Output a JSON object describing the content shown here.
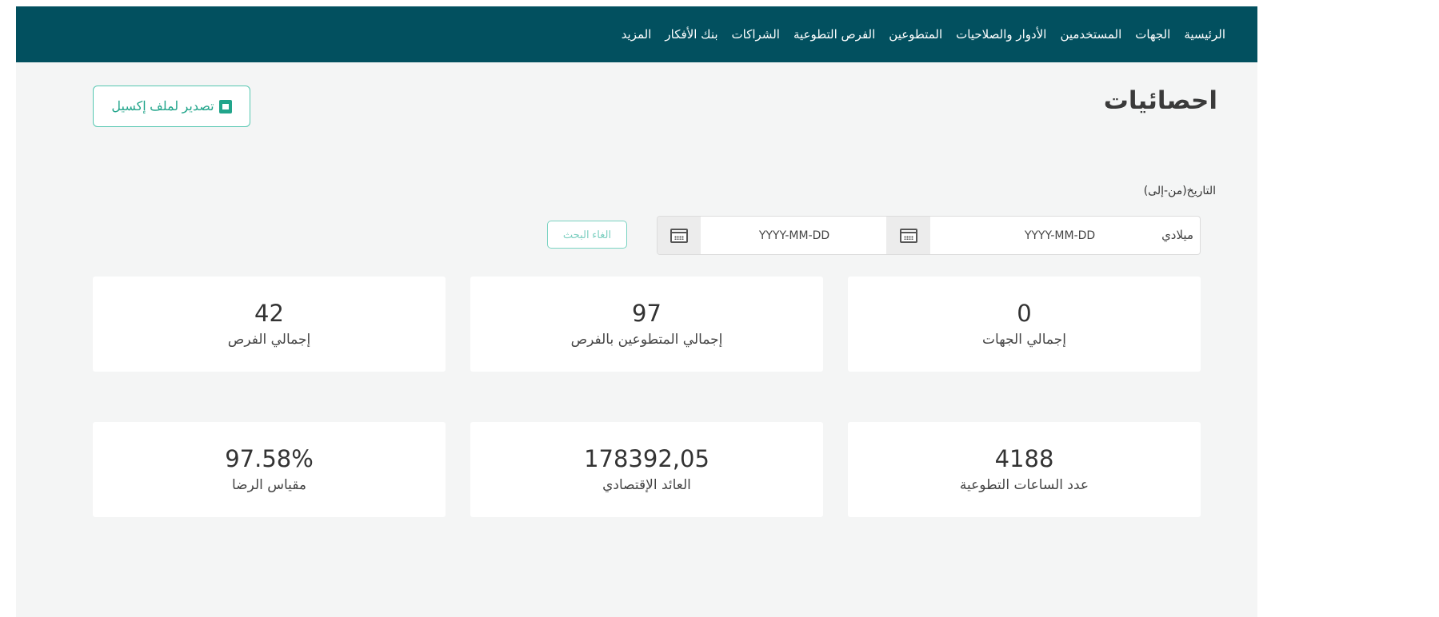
{
  "nav": {
    "items": [
      {
        "label": "الرئيسية"
      },
      {
        "label": "الجهات"
      },
      {
        "label": "المستخدمين"
      },
      {
        "label": "الأدوار والصلاحيات"
      },
      {
        "label": "المتطوعين"
      },
      {
        "label": "الفرص التطوعية"
      },
      {
        "label": "الشراكات"
      },
      {
        "label": "بنك الأفكار"
      },
      {
        "label": "المزيد"
      }
    ]
  },
  "page": {
    "title": "احصائيات",
    "export_label": "تصدير لملف إكسيل"
  },
  "filters": {
    "date_label": "التاريخ(من-إلى)",
    "calendar_type": "ميلادي",
    "from_placeholder": "YYYY-MM-DD",
    "to_placeholder": "YYYY-MM-DD",
    "cancel_label": "الغاء البحث"
  },
  "stats": [
    {
      "value": "0",
      "label": "إجمالي الجهات"
    },
    {
      "value": "97",
      "label": "إجمالي المتطوعين بالفرص"
    },
    {
      "value": "42",
      "label": "إجمالي الفرص"
    },
    {
      "value": "4188",
      "label": "عدد الساعات التطوعية"
    },
    {
      "value": "178392,05",
      "label": "العائد الإقتصادي"
    },
    {
      "value": "97.58%",
      "label": "مقياس الرضا"
    }
  ],
  "colors": {
    "navbar": "#02505f",
    "accent": "#22a58b",
    "background": "#f4f5f5"
  }
}
